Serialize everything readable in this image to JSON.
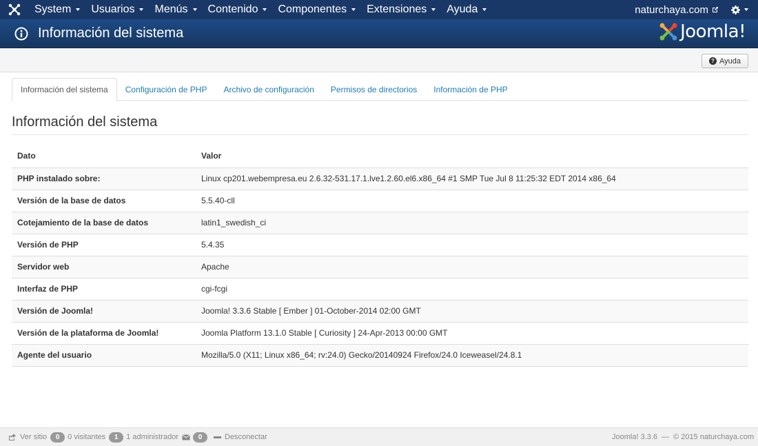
{
  "navbar": {
    "menu": [
      {
        "label": "System"
      },
      {
        "label": "Usuarios"
      },
      {
        "label": "Menús"
      },
      {
        "label": "Contenido"
      },
      {
        "label": "Componentes"
      },
      {
        "label": "Extensiones"
      },
      {
        "label": "Ayuda"
      }
    ],
    "site_name": "naturchaya.com"
  },
  "header": {
    "title": "Información del sistema",
    "brand": "Joomla!"
  },
  "toolbar": {
    "help_label": "Ayuda"
  },
  "tabs": [
    {
      "label": "Información del sistema",
      "active": true
    },
    {
      "label": "Configuración de PHP",
      "active": false
    },
    {
      "label": "Archivo de configuración",
      "active": false
    },
    {
      "label": "Permisos de directorios",
      "active": false
    },
    {
      "label": "Información de PHP",
      "active": false
    }
  ],
  "section": {
    "title": "Información del sistema"
  },
  "table": {
    "headers": [
      "Dato",
      "Valor"
    ],
    "rows": [
      {
        "key": "PHP instalado sobre:",
        "value": "Linux cp201.webempresa.eu 2.6.32-531.17.1.lve1.2.60.el6.x86_64 #1 SMP Tue Jul 8 11:25:32 EDT 2014 x86_64"
      },
      {
        "key": "Versión de la base de datos",
        "value": "5.5.40-cll"
      },
      {
        "key": "Cotejamiento de la base de datos",
        "value": "latin1_swedish_ci"
      },
      {
        "key": "Versión de PHP",
        "value": "5.4.35"
      },
      {
        "key": "Servidor web",
        "value": "Apache"
      },
      {
        "key": "Interfaz de PHP",
        "value": "cgi-fcgi"
      },
      {
        "key": "Versión de Joomla!",
        "value": "Joomla! 3.3.6 Stable [ Ember ] 01-October-2014 02:00 GMT"
      },
      {
        "key": "Versión de la plataforma de Joomla!",
        "value": "Joomla Platform 13.1.0 Stable [ Curiosity ] 24-Apr-2013 00:00 GMT"
      },
      {
        "key": "Agente del usuario",
        "value": "Mozilla/5.0 (X11; Linux x86_64; rv:24.0) Gecko/20140924 Firefox/24.0 Iceweasel/24.8.1"
      }
    ]
  },
  "status": {
    "view_site": "Ver sitio",
    "visitors_count": "0",
    "visitors_label": "0 visitantes",
    "admins_count": "1",
    "admins_label": "1 administrador",
    "messages_count": "0",
    "logout": "Desconectar",
    "version": "Joomla! 3.3.6",
    "separator": "—",
    "copyright": "© 2015 naturchaya.com"
  },
  "colors": {
    "navbar": "#1a3867",
    "header": "#1d4a86",
    "link": "#1f7bb6"
  }
}
